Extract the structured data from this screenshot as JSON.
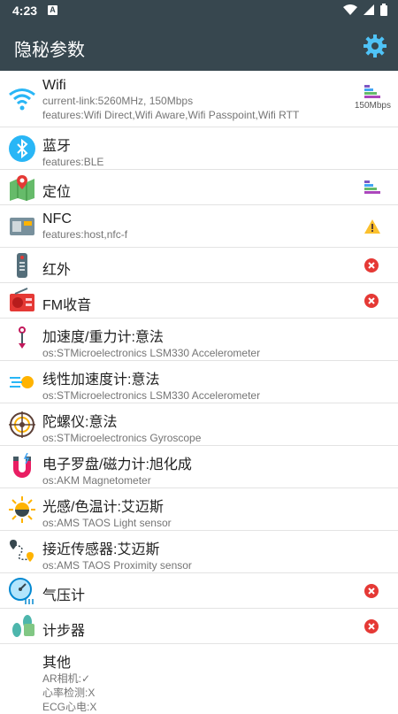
{
  "status": {
    "time": "4:23",
    "notif_letter": "A"
  },
  "appbar": {
    "title": "隐秘参数"
  },
  "items": [
    {
      "name": "Wifi",
      "sub1": "current-link:5260MHz, 150Mbps",
      "sub2": "features:Wifi Direct,Wifi Aware,Wifi Passpoint,Wifi RTT",
      "status_label": "150Mbps"
    },
    {
      "name": "蓝牙",
      "sub1": "features:BLE"
    },
    {
      "name": "定位"
    },
    {
      "name": "NFC",
      "sub1": "features:host,nfc-f"
    },
    {
      "name": "红外"
    },
    {
      "name": "FM收音"
    },
    {
      "name": "加速度/重力计:意法",
      "sub1": "os:STMicroelectronics LSM330 Accelerometer"
    },
    {
      "name": "线性加速度计:意法",
      "sub1": "os:STMicroelectronics LSM330 Accelerometer"
    },
    {
      "name": "陀螺仪:意法",
      "sub1": "os:STMicroelectronics Gyroscope"
    },
    {
      "name": "电子罗盘/磁力计:旭化成",
      "sub1": "os:AKM Magnetometer"
    },
    {
      "name": "光感/色温计:艾迈斯",
      "sub1": "os:AMS TAOS Light sensor"
    },
    {
      "name": "接近传感器:艾迈斯",
      "sub1": "os:AMS TAOS Proximity sensor"
    },
    {
      "name": "气压计"
    },
    {
      "name": "计步器"
    },
    {
      "name": "其他",
      "sub1": "AR相机:✓",
      "sub2": "心率检测:X",
      "sub3": "ECG心电:X"
    }
  ],
  "colors": {
    "appbar": "#37474f",
    "error": "#e53935",
    "warning": "#fbc02d",
    "accent": "#03a9f4"
  }
}
